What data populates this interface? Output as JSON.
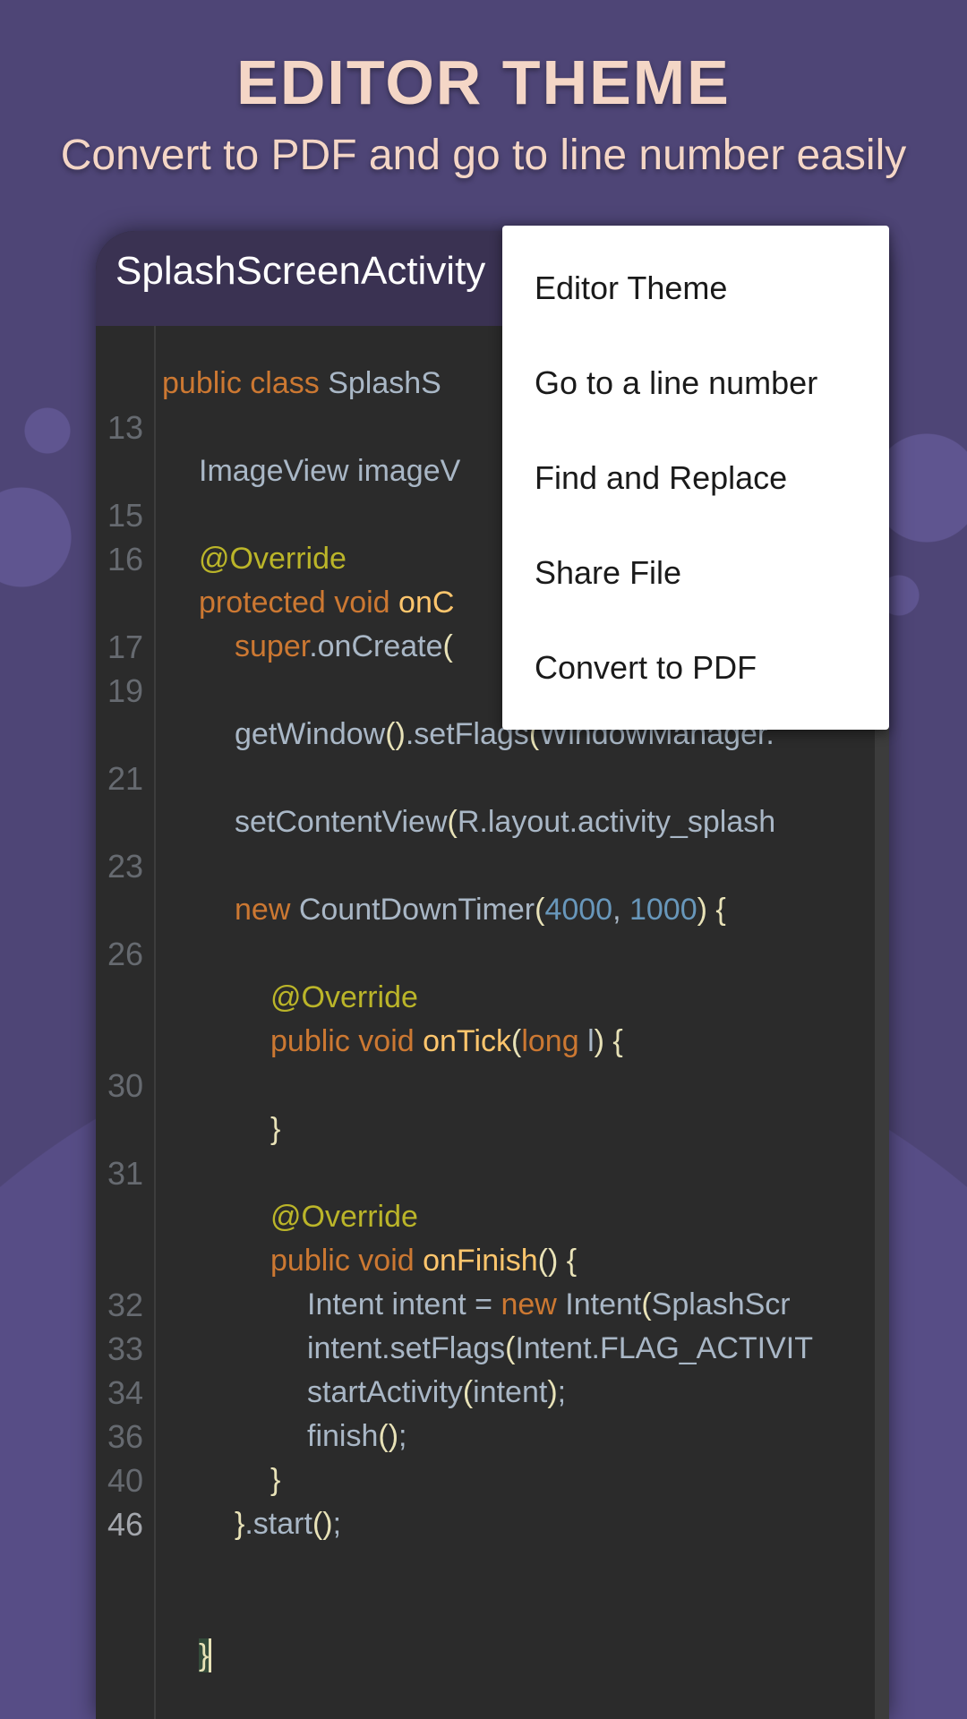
{
  "hero": {
    "title": "EDITOR THEME",
    "subtitle": "Convert to PDF and go to line number easily"
  },
  "editor": {
    "title": "SplashScreenActivity",
    "rows": [
      {
        "ln": "",
        "indent": 0,
        "t": [
          [
            "kw",
            "public class "
          ],
          [
            "",
            "SplashS"
          ]
        ]
      },
      {
        "ln": "13",
        "indent": 0,
        "t": []
      },
      {
        "ln": "",
        "indent": 1,
        "t": [
          [
            "",
            "ImageView imageV"
          ]
        ]
      },
      {
        "ln": "15",
        "indent": 0,
        "t": []
      },
      {
        "ln": "16",
        "indent": 1,
        "t": [
          [
            "an",
            "@Override"
          ]
        ]
      },
      {
        "ln": "",
        "indent": 1,
        "t": [
          [
            "kw",
            "protected void "
          ],
          [
            "fn",
            "onC"
          ]
        ]
      },
      {
        "ln": "17",
        "indent": 2,
        "t": [
          [
            "kw",
            "super"
          ],
          [
            "",
            ".onCreate"
          ],
          [
            "pn",
            "("
          ]
        ]
      },
      {
        "ln": "19",
        "indent": 0,
        "t": []
      },
      {
        "ln": "",
        "indent": 2,
        "t": [
          [
            "",
            "getWindow"
          ],
          [
            "pn",
            "()"
          ],
          [
            "",
            ".setFlags"
          ],
          [
            "pn",
            "("
          ],
          [
            "",
            "WindowManager."
          ]
        ]
      },
      {
        "ln": "21",
        "indent": 0,
        "t": []
      },
      {
        "ln": "",
        "indent": 2,
        "t": [
          [
            "",
            "setContentView"
          ],
          [
            "pn",
            "("
          ],
          [
            "",
            "R.layout.activity_splash"
          ]
        ]
      },
      {
        "ln": "23",
        "indent": 0,
        "t": []
      },
      {
        "ln": "",
        "indent": 2,
        "t": [
          [
            "kw",
            "new "
          ],
          [
            "",
            "CountDownTimer"
          ],
          [
            "pn",
            "("
          ],
          [
            "num",
            "4000"
          ],
          [
            "",
            ", "
          ],
          [
            "num",
            "1000"
          ],
          [
            "pn",
            ") {"
          ]
        ]
      },
      {
        "ln": "26",
        "indent": 0,
        "t": []
      },
      {
        "ln": "",
        "indent": 3,
        "t": [
          [
            "an",
            "@Override"
          ]
        ]
      },
      {
        "ln": "",
        "indent": 3,
        "t": [
          [
            "kw",
            "public void "
          ],
          [
            "fn",
            "onTick"
          ],
          [
            "pn",
            "("
          ],
          [
            "kw",
            "long "
          ],
          [
            "",
            "l"
          ],
          [
            "pn",
            ") {"
          ]
        ]
      },
      {
        "ln": "30",
        "indent": 0,
        "t": []
      },
      {
        "ln": "",
        "indent": 3,
        "t": [
          [
            "pn",
            "}"
          ]
        ]
      },
      {
        "ln": "31",
        "indent": 0,
        "t": []
      },
      {
        "ln": "",
        "indent": 3,
        "t": [
          [
            "an",
            "@Override"
          ]
        ]
      },
      {
        "ln": "",
        "indent": 3,
        "t": [
          [
            "kw",
            "public void "
          ],
          [
            "fn",
            "onFinish"
          ],
          [
            "pn",
            "() {"
          ]
        ]
      },
      {
        "ln": "32",
        "indent": 4,
        "t": [
          [
            "",
            "Intent intent = "
          ],
          [
            "kw",
            "new "
          ],
          [
            "",
            "Intent"
          ],
          [
            "pn",
            "("
          ],
          [
            "",
            "SplashScr"
          ]
        ]
      },
      {
        "ln": "33",
        "indent": 4,
        "t": [
          [
            "",
            "intent.setFlags"
          ],
          [
            "pn",
            "("
          ],
          [
            "",
            "Intent.FLAG_ACTIVIT"
          ]
        ]
      },
      {
        "ln": "34",
        "indent": 4,
        "t": [
          [
            "",
            "startActivity"
          ],
          [
            "pn",
            "("
          ],
          [
            "",
            "intent"
          ],
          [
            "pn",
            ")"
          ],
          [
            "",
            ";"
          ]
        ]
      },
      {
        "ln": "36",
        "indent": 4,
        "t": [
          [
            "",
            "finish"
          ],
          [
            "pn",
            "()"
          ],
          [
            "",
            ";"
          ]
        ]
      },
      {
        "ln": "40",
        "indent": 3,
        "t": [
          [
            "pn",
            "}"
          ]
        ]
      },
      {
        "ln": "46",
        "indent": 2,
        "current": true,
        "t": [
          [
            "pn",
            "}"
          ],
          [
            "",
            ".start"
          ],
          [
            "pn",
            "()"
          ],
          [
            "",
            ";"
          ]
        ]
      },
      {
        "ln": "",
        "indent": 0,
        "t": []
      },
      {
        "ln": "",
        "indent": 0,
        "t": []
      },
      {
        "ln": "",
        "indent": 1,
        "t": [
          [
            "cursor",
            "}"
          ]
        ]
      }
    ]
  },
  "menu": {
    "items": [
      "Editor Theme",
      "Go to a line number",
      "Find and Replace",
      "Share File",
      "Convert to PDF"
    ]
  },
  "colors": {
    "background": "#4e4576",
    "accent_text": "#f4d6c6",
    "keyword": "#cc7832",
    "function": "#ffc66d",
    "annotation": "#bbb529",
    "number": "#6897bb"
  }
}
